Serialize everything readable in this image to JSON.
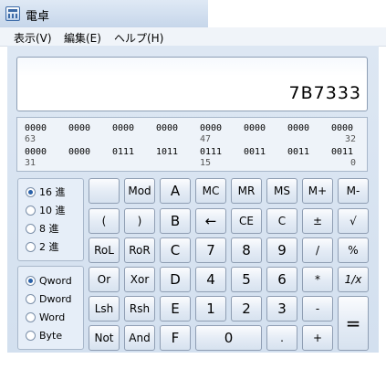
{
  "window": {
    "title": "電卓"
  },
  "menu": [
    "表示(V)",
    "編集(E)",
    "ヘルプ(H)"
  ],
  "display": {
    "value": "7B7333"
  },
  "bits": {
    "row1": [
      "0000",
      "0000",
      "0000",
      "0000",
      "0000",
      "0000",
      "0000",
      "0000"
    ],
    "row1_index": {
      "left": "63",
      "mid": "47",
      "right": "32"
    },
    "row2": [
      "0000",
      "0000",
      "0111",
      "1011",
      "0111",
      "0011",
      "0011",
      "0011"
    ],
    "row2_index": {
      "left": "31",
      "mid": "15",
      "right": "0"
    }
  },
  "base_options": [
    {
      "label": "16 進",
      "selected": true
    },
    {
      "label": "10 進",
      "selected": false
    },
    {
      "label": "8 進",
      "selected": false
    },
    {
      "label": "2 進",
      "selected": false
    }
  ],
  "word_options": [
    {
      "label": "Qword",
      "selected": true
    },
    {
      "label": "Dword",
      "selected": false
    },
    {
      "label": "Word",
      "selected": false
    },
    {
      "label": "Byte",
      "selected": false
    }
  ],
  "keys": {
    "mod": "Mod",
    "a": "A",
    "mc": "MC",
    "mr": "MR",
    "ms": "MS",
    "mplus": "M+",
    "mminus": "M-",
    "lparen": "(",
    "rparen": ")",
    "b": "B",
    "back": "←",
    "ce": "CE",
    "c": "C",
    "plusminus": "±",
    "sqrt": "√",
    "rol": "RoL",
    "ror": "RoR",
    "hex_c": "C",
    "n7": "7",
    "n8": "8",
    "n9": "9",
    "div": "/",
    "pct": "%",
    "or": "Or",
    "xor": "Xor",
    "d": "D",
    "n4": "4",
    "n5": "5",
    "n6": "6",
    "mul": "*",
    "recip": "1/x",
    "lsh": "Lsh",
    "rsh": "Rsh",
    "e": "E",
    "n1": "1",
    "n2": "2",
    "n3": "3",
    "sub": "-",
    "eq": "=",
    "not": "Not",
    "and": "And",
    "f": "F",
    "n0": "0",
    "dot": ".",
    "add": "+"
  }
}
